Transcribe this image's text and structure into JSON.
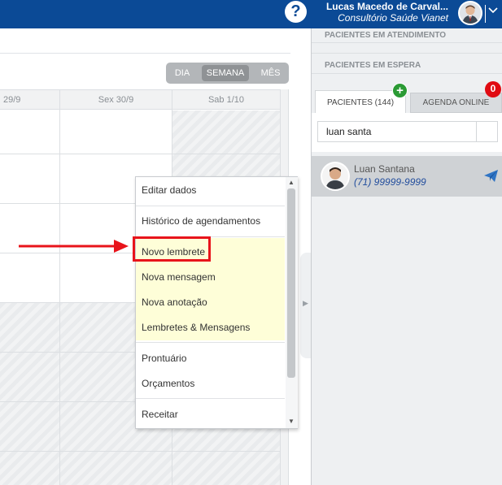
{
  "topbar": {
    "help_icon": "?",
    "user_name": "Lucas Macedo de Carval...",
    "clinic_name": "Consultório Saúde Vianet",
    "menu_chevron": "﹀"
  },
  "calendar": {
    "views": {
      "day": "DIA",
      "week": "SEMANA",
      "month": "MÊS",
      "active": "SEMANA"
    },
    "day_headers": [
      "29/9",
      "Sex 30/9",
      "Sab 1/10"
    ]
  },
  "context_menu": {
    "items": [
      "Editar dados",
      "Histórico de agendamentos",
      "Novo lembrete",
      "Nova mensagem",
      "Nova anotação",
      "Lembretes & Mensagens",
      "Prontuário",
      "Orçamentos",
      "Receitar"
    ],
    "highlight_color": "#fefed8"
  },
  "annotation": {
    "color": "#e8141b",
    "target": "Novo lembrete"
  },
  "right_panel": {
    "in_service_title": "PACIENTES EM ATENDIMENTO",
    "waiting_title": "PACIENTES EM ESPERA",
    "tab_patients": "PACIENTES (144)",
    "tab_online": "AGENDA ONLINE",
    "add_badge": "+",
    "online_count": "0",
    "search_value": "luan santa",
    "patient": {
      "name": "Luan Santana",
      "phone": "(71) 99999-9999"
    }
  },
  "colors": {
    "brand": "#0b4a96",
    "add": "#2a9a34",
    "badge": "#e00b12",
    "link": "#1f4b9c"
  }
}
